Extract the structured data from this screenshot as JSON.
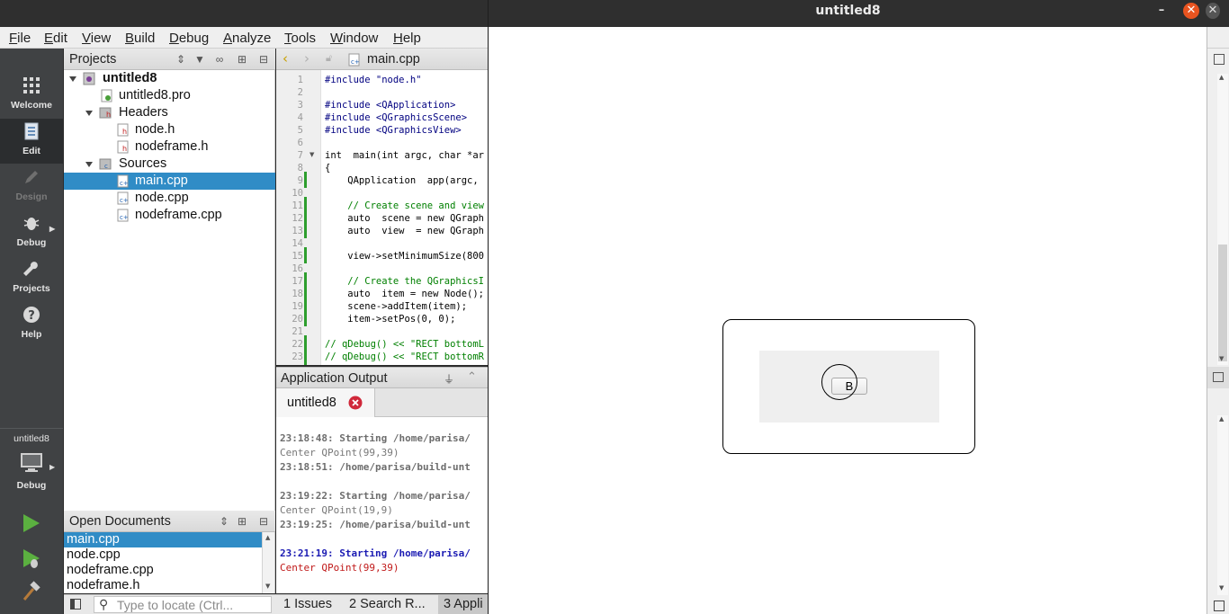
{
  "ide": {
    "menu": [
      {
        "label": "File",
        "ul": "F",
        "rest": "ile"
      },
      {
        "label": "Edit",
        "ul": "E",
        "rest": "dit"
      },
      {
        "label": "View",
        "ul": "V",
        "rest": "iew"
      },
      {
        "label": "Build",
        "ul": "B",
        "rest": "uild"
      },
      {
        "label": "Debug",
        "ul": "D",
        "rest": "ebug"
      },
      {
        "label": "Analyze",
        "ul": "A",
        "rest": "nalyze"
      },
      {
        "label": "Tools",
        "ul": "T",
        "rest": "ools"
      },
      {
        "label": "Window",
        "ul": "W",
        "rest": "indow"
      },
      {
        "label": "Help",
        "ul": "H",
        "rest": "elp"
      }
    ],
    "modes": {
      "welcome": "Welcome",
      "edit": "Edit",
      "design": "Design",
      "debug": "Debug",
      "projects": "Projects",
      "help": "Help"
    },
    "kit": {
      "project": "untitled8",
      "config": "Debug"
    },
    "projects_pane": {
      "title": "Projects",
      "tree": {
        "root": "untitled8",
        "pro": "untitled8.pro",
        "headers": "Headers",
        "h1": "node.h",
        "h2": "nodeframe.h",
        "sources": "Sources",
        "s1": "main.cpp",
        "s2": "node.cpp",
        "s3": "nodeframe.cpp"
      }
    },
    "open_documents": {
      "title": "Open Documents",
      "items": [
        "main.cpp",
        "node.cpp",
        "nodeframe.cpp",
        "nodeframe.h"
      ]
    },
    "editor": {
      "file_tab": "main.cpp",
      "lines": [
        {
          "n": "1",
          "t": "#include \"node.h\""
        },
        {
          "n": "2",
          "t": ""
        },
        {
          "n": "3",
          "t": "#include <QApplication>"
        },
        {
          "n": "4",
          "t": "#include <QGraphicsScene>"
        },
        {
          "n": "5",
          "t": "#include <QGraphicsView>"
        },
        {
          "n": "6",
          "t": ""
        },
        {
          "n": "7",
          "t": "int  main(int argc, char *ar"
        },
        {
          "n": "8",
          "t": "{"
        },
        {
          "n": "9",
          "t": "    QApplication  app(argc, "
        },
        {
          "n": "10",
          "t": ""
        },
        {
          "n": "11",
          "t": "    // Create scene and view"
        },
        {
          "n": "12",
          "t": "    auto  scene = new QGraph"
        },
        {
          "n": "13",
          "t": "    auto  view  = new QGraph"
        },
        {
          "n": "14",
          "t": ""
        },
        {
          "n": "15",
          "t": "    view->setMinimumSize(800"
        },
        {
          "n": "16",
          "t": ""
        },
        {
          "n": "17",
          "t": "    // Create the QGraphicsI"
        },
        {
          "n": "18",
          "t": "    auto  item = new Node();"
        },
        {
          "n": "19",
          "t": "    scene->addItem(item);"
        },
        {
          "n": "20",
          "t": "    item->setPos(0, 0);"
        },
        {
          "n": "21",
          "t": ""
        },
        {
          "n": "22",
          "t": "// qDebug() << \"RECT bottomL"
        },
        {
          "n": "23",
          "t": "// qDebug() << \"RECT bottomR"
        }
      ]
    },
    "output": {
      "title": "Application Output",
      "tab": "untitled8",
      "lines": [
        {
          "cls": "b",
          "t": "23:18:48: Starting /home/parisa/"
        },
        {
          "cls": "g",
          "t": "Center QPoint(99,39)"
        },
        {
          "cls": "b",
          "t": "23:18:51: /home/parisa/build-unt"
        },
        {
          "cls": "g",
          "t": ""
        },
        {
          "cls": "b",
          "t": "23:19:22: Starting /home/parisa/"
        },
        {
          "cls": "g",
          "t": "Center QPoint(19,9)"
        },
        {
          "cls": "b",
          "t": "23:19:25: /home/parisa/build-unt"
        },
        {
          "cls": "g",
          "t": ""
        },
        {
          "cls": "blue",
          "t": "23:21:19: Starting /home/parisa/"
        },
        {
          "cls": "red",
          "t": "Center QPoint(99,39)"
        }
      ]
    },
    "statusbar": {
      "locator_placeholder": "Type to locate (Ctrl...",
      "issues": "1  Issues",
      "search": "2  Search R...",
      "appout": "3  Appli"
    }
  },
  "app_window": {
    "title": "untitled8",
    "button_label": "B"
  },
  "colors": {
    "selection": "#308cc6",
    "sidebar": "#404244",
    "close_button": "#e95420"
  }
}
